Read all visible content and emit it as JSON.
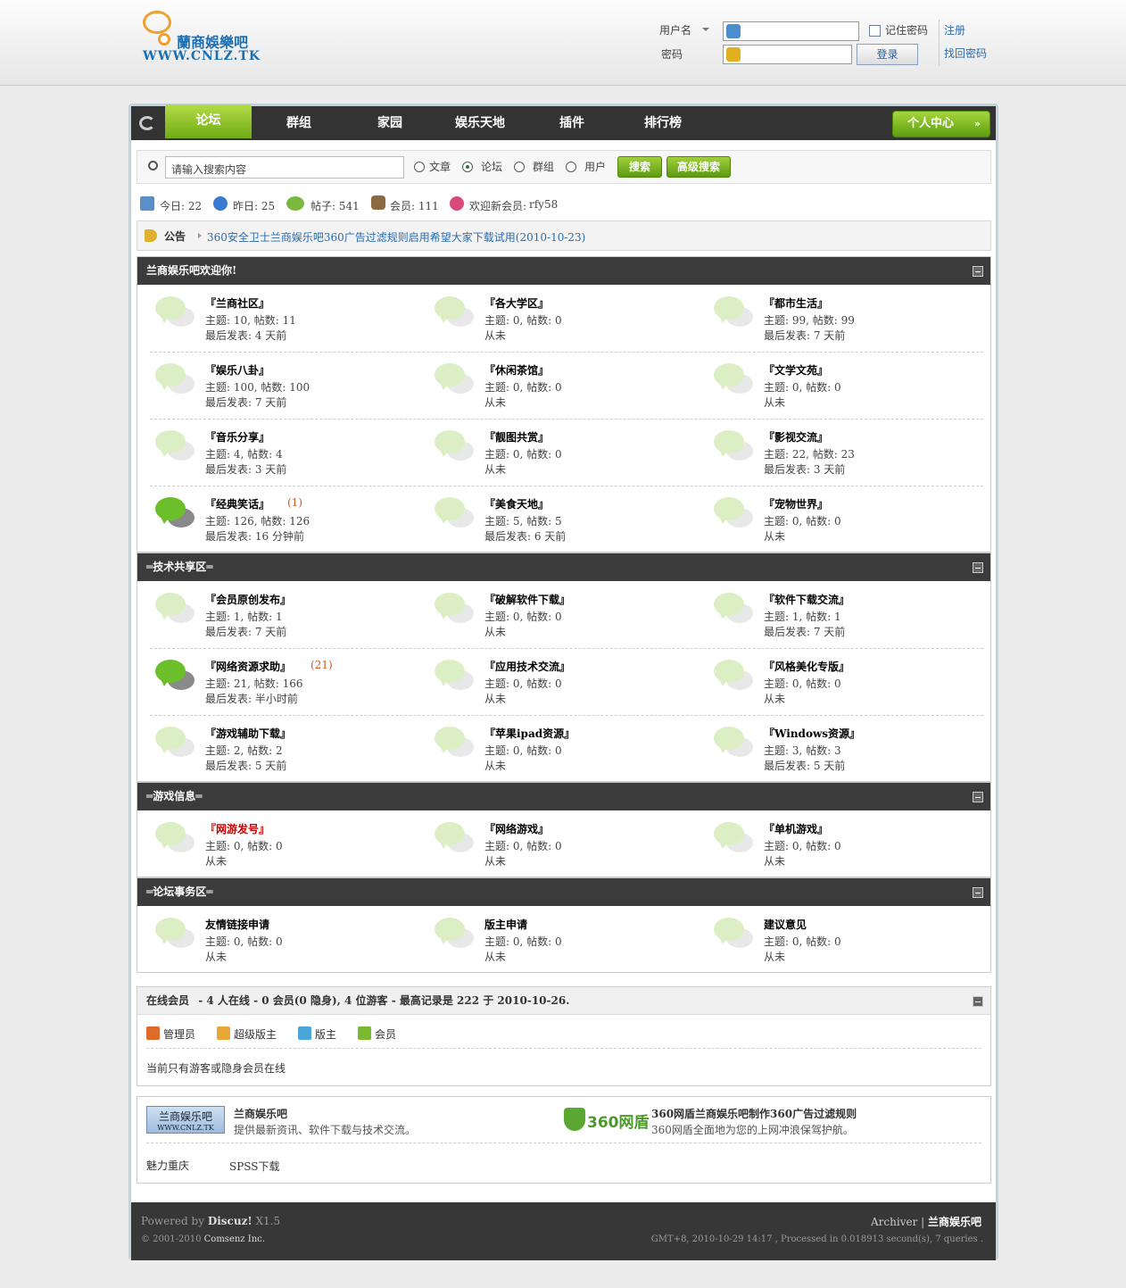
{
  "header": {
    "logo_cn": "蘭商娛樂吧",
    "logo_en": "WWW.CNLZ.TK",
    "username_label": "用户名",
    "password_label": "密码",
    "remember_label": "记住密码",
    "login_button": "登录",
    "register_link": "注册",
    "forgot_link": "找回密码"
  },
  "nav": {
    "items": [
      "论坛",
      "群组",
      "家园",
      "娱乐天地",
      "插件",
      "排行榜"
    ],
    "user_center": "个人中心"
  },
  "search": {
    "placeholder": "请输入搜索内容",
    "options": [
      "文章",
      "论坛",
      "群组",
      "用户"
    ],
    "selected": "论坛",
    "search_button": "搜索",
    "advanced_button": "高级搜索"
  },
  "stats": {
    "today": "今日: 22",
    "yesterday": "昨日: 25",
    "posts": "帖子: 541",
    "members": "会员: 111",
    "newmember_label": "欢迎新会员:",
    "newmember": "rfy58"
  },
  "notice": {
    "label": "公告",
    "text": "360安全卫士兰商娱乐吧360广告过滤规则启用希望大家下载试用(2010-10-23)"
  },
  "sections": [
    {
      "title": "兰商娱乐吧欢迎你!",
      "forums": [
        {
          "name": "『兰商社区』",
          "stats": "主题: 10, 帖数: 11",
          "last": "最后发表: 4 天前"
        },
        {
          "name": "『各大学区』",
          "stats": "主题: 0, 帖数: 0",
          "last": "从未"
        },
        {
          "name": "『都市生活』",
          "stats": "主题: 99, 帖数: 99",
          "last": "最后发表: 7 天前"
        },
        {
          "name": "『娱乐八卦』",
          "stats": "主题: 100, 帖数: 100",
          "last": "最后发表: 7 天前"
        },
        {
          "name": "『休闲茶馆』",
          "stats": "主题: 0, 帖数: 0",
          "last": "从未"
        },
        {
          "name": "『文学文苑』",
          "stats": "主题: 0, 帖数: 0",
          "last": "从未"
        },
        {
          "name": "『音乐分享』",
          "stats": "主题: 4, 帖数: 4",
          "last": "最后发表: 3 天前"
        },
        {
          "name": "『靓图共赏』",
          "stats": "主题: 0, 帖数: 0",
          "last": "从未"
        },
        {
          "name": "『影视交流』",
          "stats": "主题: 22, 帖数: 23",
          "last": "最后发表: 3 天前"
        },
        {
          "name": "『经典笑话』",
          "new": "(1)",
          "active": true,
          "stats": "主题: 126, 帖数: 126",
          "last": "最后发表: 16 分钟前"
        },
        {
          "name": "『美食天地』",
          "stats": "主题: 5, 帖数: 5",
          "last": "最后发表: 6 天前"
        },
        {
          "name": "『宠物世界』",
          "stats": "主题: 0, 帖数: 0",
          "last": "从未"
        }
      ]
    },
    {
      "title": "═技术共享区═",
      "forums": [
        {
          "name": "『会员原创发布』",
          "stats": "主题: 1, 帖数: 1",
          "last": "最后发表: 7 天前"
        },
        {
          "name": "『破解软件下载』",
          "stats": "主题: 0, 帖数: 0",
          "last": "从未"
        },
        {
          "name": "『软件下载交流』",
          "stats": "主题: 1, 帖数: 1",
          "last": "最后发表: 7 天前"
        },
        {
          "name": "『网络资源求助』",
          "new": "(21)",
          "active": true,
          "stats": "主题: 21, 帖数: 166",
          "last": "最后发表: 半小时前"
        },
        {
          "name": "『应用技术交流』",
          "stats": "主题: 0, 帖数: 0",
          "last": "从未"
        },
        {
          "name": "『风格美化专版』",
          "stats": "主题: 0, 帖数: 0",
          "last": "从未"
        },
        {
          "name": "『游戏辅助下载』",
          "stats": "主题: 2, 帖数: 2",
          "last": "最后发表: 5 天前"
        },
        {
          "name": "『苹果ipad资源』",
          "stats": "主题: 0, 帖数: 0",
          "last": "从未"
        },
        {
          "name": "『Windows资源』",
          "stats": "主题: 3, 帖数: 3",
          "last": "最后发表: 5 天前"
        }
      ]
    },
    {
      "title": "═游戏信息═",
      "forums": [
        {
          "name": "『网游发号』",
          "red": true,
          "stats": "主题: 0, 帖数: 0",
          "last": "从未"
        },
        {
          "name": "『网络游戏』",
          "stats": "主题: 0, 帖数: 0",
          "last": "从未"
        },
        {
          "name": "『单机游戏』",
          "stats": "主题: 0, 帖数: 0",
          "last": "从未"
        }
      ]
    },
    {
      "title": "═论坛事务区═",
      "forums": [
        {
          "name": "友情链接申请",
          "stats": "主题: 0, 帖数: 0",
          "last": "从未"
        },
        {
          "name": "版主申请",
          "stats": "主题: 0, 帖数: 0",
          "last": "从未"
        },
        {
          "name": "建议意见",
          "stats": "主题: 0, 帖数: 0",
          "last": "从未"
        }
      ]
    }
  ],
  "online": {
    "title": "在线会员",
    "summary": "- 4 人在线 - 0 会员(0 隐身), 4 位游客 - 最高记录是 222 于 2010-10-26.",
    "legend": [
      "管理员",
      "超级版主",
      "版主",
      "会员"
    ],
    "note": "当前只有游客或隐身会员在线"
  },
  "links": {
    "site1_logo": "兰商娱乐吧",
    "site1_logo_url": "WWW.CNLZ.TK",
    "site1_name": "兰商娱乐吧",
    "site1_desc": "提供最新资讯、软件下载与技术交流。",
    "site2_logo": "360网盾",
    "site2_name": "360网盾兰商娱乐吧制作360广告过滤规则",
    "site2_desc": "360网盾全面地为您的上网冲浪保驾护航。",
    "text_links": [
      "魅力重庆",
      "SPSS下载"
    ]
  },
  "footer": {
    "powered_prefix": "Powered by",
    "powered_name": "Discuz!",
    "powered_ver": "X1.5",
    "copyright_prefix": "© 2001-2010",
    "copyright_company": "Comsenz Inc.",
    "archiver": "Archiver",
    "site_name": "兰商娱乐吧",
    "info": "GMT+8, 2010-10-29 14:17 , Processed in 0.018913 second(s), 7 queries ."
  }
}
